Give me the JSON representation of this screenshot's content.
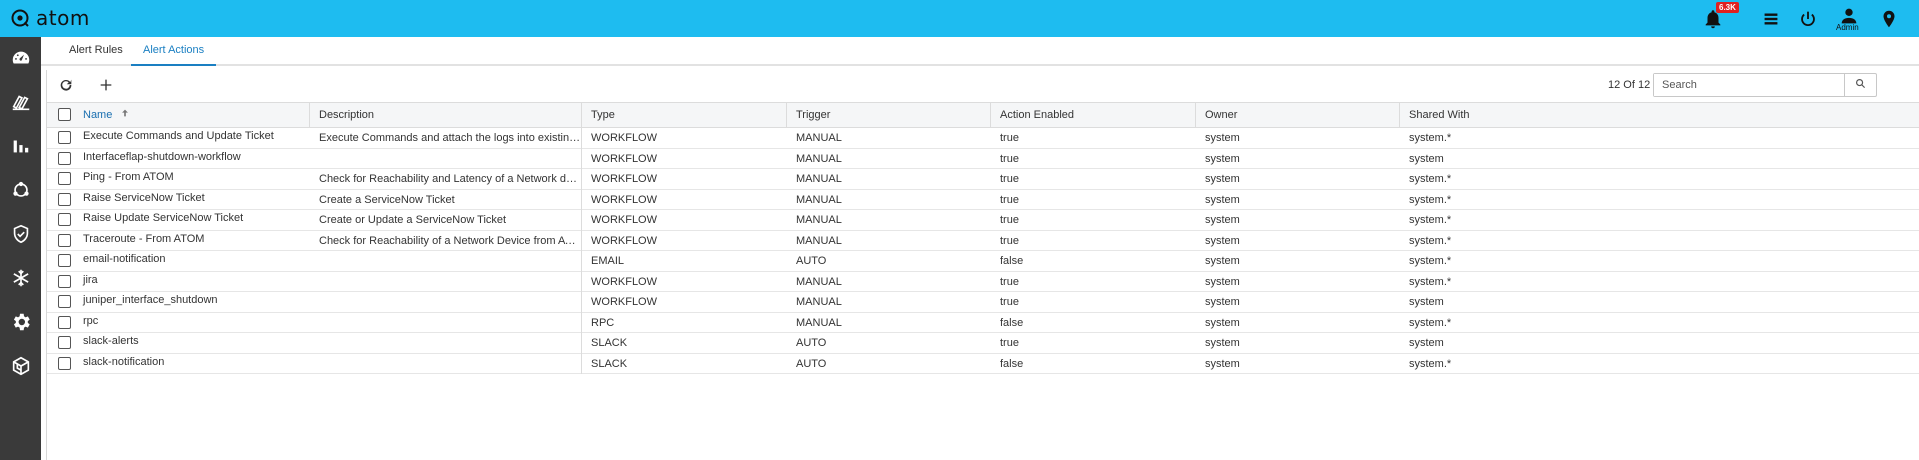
{
  "app": {
    "title": "atom",
    "notification_count": "6.3K",
    "user_label": "Admin"
  },
  "icons": {
    "logo": "atom-logo-icon",
    "bell": "bell-icon",
    "list": "list-icon",
    "power": "power-icon",
    "user": "user-icon",
    "location": "location-pin-icon"
  },
  "colors": {
    "topbar": "#1ebcf0",
    "sidenav": "#3a3a3a",
    "accent": "#1a7fc2",
    "badge": "#e02020"
  },
  "sidebar": {
    "items": [
      {
        "icon": "dashboard-icon"
      },
      {
        "icon": "inventory-icon"
      },
      {
        "icon": "bar-chart-icon"
      },
      {
        "icon": "topology-icon"
      },
      {
        "icon": "shield-check-icon"
      },
      {
        "icon": "snowflake-icon"
      },
      {
        "icon": "gear-icon"
      },
      {
        "icon": "cube-icon"
      }
    ]
  },
  "tabs": [
    {
      "label": "Alert Rules",
      "active": false
    },
    {
      "label": "Alert Actions",
      "active": true
    }
  ],
  "toolbar": {
    "refresh_icon": "refresh-icon",
    "add_icon": "plus-icon",
    "count": "12 Of 12",
    "search_placeholder": "Search",
    "search_icon": "search-icon"
  },
  "table": {
    "columns": [
      "Name",
      "Description",
      "Type",
      "Trigger",
      "Action Enabled",
      "Owner",
      "Shared With"
    ],
    "sorted_column": "Name",
    "sort_direction": "ascending",
    "rows": [
      [
        "Execute Commands and Update Ticket",
        "Execute Commands and attach the logs into existing Ticket",
        "WORKFLOW",
        "MANUAL",
        "true",
        "system",
        "system.*"
      ],
      [
        "Interfaceflap-shutdown-workflow",
        "",
        "WORKFLOW",
        "MANUAL",
        "true",
        "system",
        "system"
      ],
      [
        "Ping - From ATOM",
        "Check for Reachability and Latency of a Network device from A...",
        "WORKFLOW",
        "MANUAL",
        "true",
        "system",
        "system.*"
      ],
      [
        "Raise ServiceNow Ticket",
        "Create a ServiceNow Ticket",
        "WORKFLOW",
        "MANUAL",
        "true",
        "system",
        "system.*"
      ],
      [
        "Raise Update ServiceNow Ticket",
        "Create or Update a ServiceNow Ticket",
        "WORKFLOW",
        "MANUAL",
        "true",
        "system",
        "system.*"
      ],
      [
        "Traceroute - From ATOM",
        "Check for Reachability of a Network Device from ATOM throug...",
        "WORKFLOW",
        "MANUAL",
        "true",
        "system",
        "system.*"
      ],
      [
        "email-notification",
        "",
        "EMAIL",
        "AUTO",
        "false",
        "system",
        "system.*"
      ],
      [
        "jira",
        "",
        "WORKFLOW",
        "MANUAL",
        "true",
        "system",
        "system.*"
      ],
      [
        "juniper_interface_shutdown",
        "",
        "WORKFLOW",
        "MANUAL",
        "true",
        "system",
        "system"
      ],
      [
        "rpc",
        "",
        "RPC",
        "MANUAL",
        "false",
        "system",
        "system.*"
      ],
      [
        "slack-alerts",
        "",
        "SLACK",
        "AUTO",
        "true",
        "system",
        "system"
      ],
      [
        "slack-notification",
        "",
        "SLACK",
        "AUTO",
        "false",
        "system",
        "system.*"
      ]
    ]
  }
}
